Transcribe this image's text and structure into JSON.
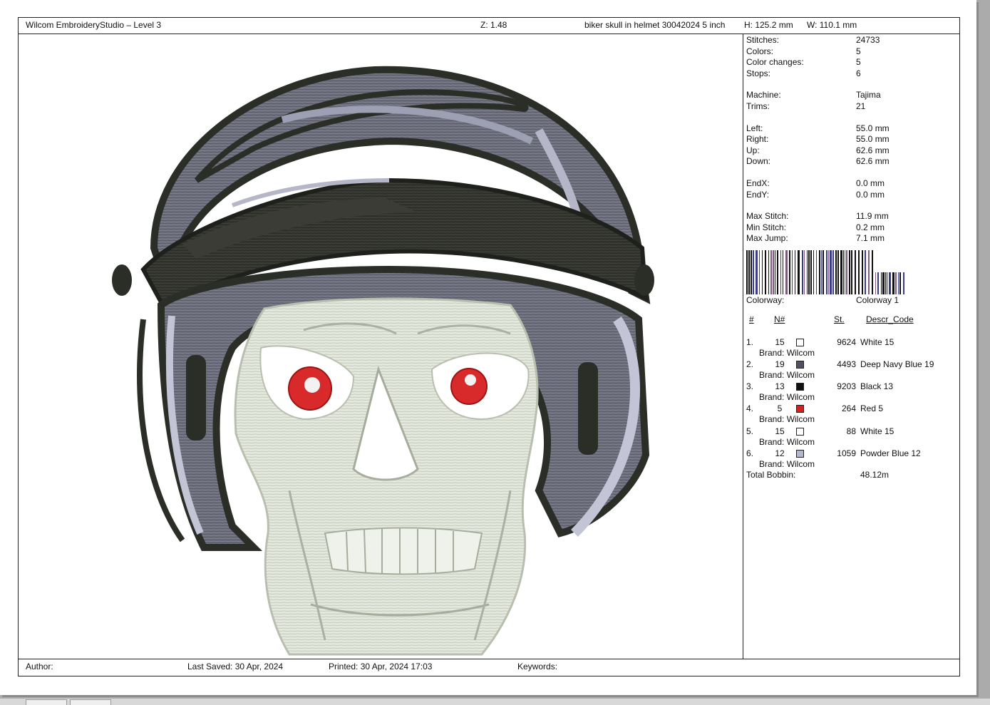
{
  "header": {
    "app_title": "Wilcom EmbroideryStudio – Level 3",
    "zoom": "Z: 1.48",
    "design_name": "biker skull in helmet 30042024 5 inch",
    "height": "H: 125.2 mm",
    "width": "W: 110.1 mm"
  },
  "stats": [
    {
      "label": "Stitches:",
      "value": "24733"
    },
    {
      "label": "Colors:",
      "value": "5"
    },
    {
      "label": "Color changes:",
      "value": "5"
    },
    {
      "label": "Stops:",
      "value": "6"
    }
  ],
  "machine_stats": [
    {
      "label": "Machine:",
      "value": "Tajima"
    },
    {
      "label": "Trims:",
      "value": "21"
    }
  ],
  "extent_stats": [
    {
      "label": "Left:",
      "value": "55.0 mm"
    },
    {
      "label": "Right:",
      "value": "55.0 mm"
    },
    {
      "label": "Up:",
      "value": "62.6 mm"
    },
    {
      "label": "Down:",
      "value": "62.6 mm"
    }
  ],
  "end_stats": [
    {
      "label": "EndX:",
      "value": "0.0 mm"
    },
    {
      "label": "EndY:",
      "value": "0.0 mm"
    }
  ],
  "stitch_stats": [
    {
      "label": "Max Stitch:",
      "value": "11.9 mm"
    },
    {
      "label": "Min Stitch:",
      "value": "0.2 mm"
    },
    {
      "label": "Max Jump:",
      "value": "7.1 mm"
    }
  ],
  "colorway": {
    "label": "Colorway:",
    "value": "Colorway 1"
  },
  "table_headers": {
    "idx": "#",
    "n": "N#",
    "st": "St.",
    "descr": "Descr_Code"
  },
  "threads": [
    {
      "idx": "1.",
      "n": "15",
      "color": "#ffffff",
      "st": "9624",
      "descr": "White 15",
      "brand": "Brand: Wilcom"
    },
    {
      "idx": "2.",
      "n": "19",
      "color": "#4f5064",
      "st": "4493",
      "descr": "Deep Navy Blue 19",
      "brand": "Brand: Wilcom"
    },
    {
      "idx": "3.",
      "n": "13",
      "color": "#111111",
      "st": "9203",
      "descr": "Black 13",
      "brand": "Brand: Wilcom"
    },
    {
      "idx": "4.",
      "n": "5",
      "color": "#d62020",
      "st": "264",
      "descr": "Red 5",
      "brand": "Brand: Wilcom"
    },
    {
      "idx": "5.",
      "n": "15",
      "color": "#ffffff",
      "st": "88",
      "descr": "White 15",
      "brand": "Brand: Wilcom"
    },
    {
      "idx": "6.",
      "n": "12",
      "color": "#b4b6cc",
      "st": "1059",
      "descr": "Powder Blue 12",
      "brand": "Brand: Wilcom"
    }
  ],
  "total_bobbin": {
    "label": "Total Bobbin:",
    "value": "48.12m"
  },
  "footer": {
    "author": "Author:",
    "last_saved": "Last Saved: 30 Apr, 2024",
    "printed": "Printed: 30 Apr, 2024 17:03",
    "keywords": "Keywords:"
  }
}
